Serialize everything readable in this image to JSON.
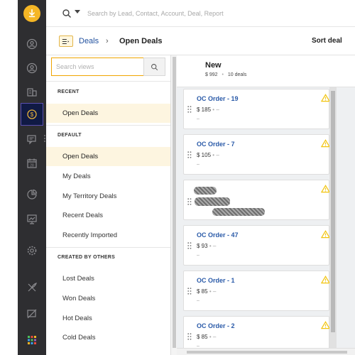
{
  "app": {
    "nav": {
      "logo_icon": "download-arrow-logo",
      "items": [
        {
          "name": "leads-icon"
        },
        {
          "name": "contacts-icon"
        },
        {
          "name": "accounts-icon"
        },
        {
          "name": "deals-icon",
          "active": true
        },
        {
          "name": "messages-icon"
        },
        {
          "name": "calendar-icon"
        },
        {
          "name": "reports-icon"
        },
        {
          "name": "insights-icon"
        },
        {
          "name": "settings-icon"
        },
        {
          "name": "campaigns-icon"
        },
        {
          "name": "workflows-icon"
        },
        {
          "name": "apps-grid-icon"
        }
      ],
      "accent": "#f5b625",
      "active_bg": "#101a44"
    },
    "search": {
      "placeholder": "Search by Lead, Contact, Account, Deal, Report"
    },
    "breadcrumb": {
      "parent": "Deals",
      "separator": "›",
      "current": "Open Deals"
    },
    "sort_label": "Sort deal"
  },
  "views": {
    "search_placeholder": "Search views",
    "sections": [
      {
        "label": "RECENT",
        "items": [
          {
            "label": "Open Deals",
            "selected": true
          }
        ]
      },
      {
        "label": "DEFAULT",
        "items": [
          {
            "label": "Open Deals",
            "selected": true
          },
          {
            "label": "My Deals"
          },
          {
            "label": "My Territory Deals"
          },
          {
            "label": "Recent Deals"
          },
          {
            "label": "Recently Imported"
          }
        ]
      },
      {
        "label": "CREATED BY OTHERS",
        "items": [
          {
            "label": "Lost Deals"
          },
          {
            "label": "Won Deals"
          },
          {
            "label": "Hot Deals"
          },
          {
            "label": "Cold Deals"
          }
        ]
      }
    ]
  },
  "board": {
    "column": {
      "title": "New",
      "total": "$ 992",
      "bullet": "•",
      "count": "10 deals"
    },
    "cards": [
      {
        "title": "OC Order - 19",
        "amount": "$ 185",
        "sep": "•",
        "owner": "–",
        "extra": "–"
      },
      {
        "title": "OC Order - 7",
        "amount": "$ 105",
        "sep": "•",
        "owner": "–",
        "extra": "–"
      },
      {
        "title": "",
        "amount": "",
        "sep": "",
        "owner": "",
        "extra": "",
        "redacted": true
      },
      {
        "title": "OC Order - 47",
        "amount": "$ 93",
        "sep": "•",
        "owner": "–",
        "extra": "–"
      },
      {
        "title": "OC Order - 1",
        "amount": "$ 85",
        "sep": "•",
        "owner": "–",
        "extra": "–"
      },
      {
        "title": "OC Order - 2",
        "amount": "$ 85",
        "sep": "•",
        "owner": "–",
        "extra": "–"
      }
    ],
    "warning_color": "#f2c40f",
    "title_color": "#2a5aa8"
  }
}
